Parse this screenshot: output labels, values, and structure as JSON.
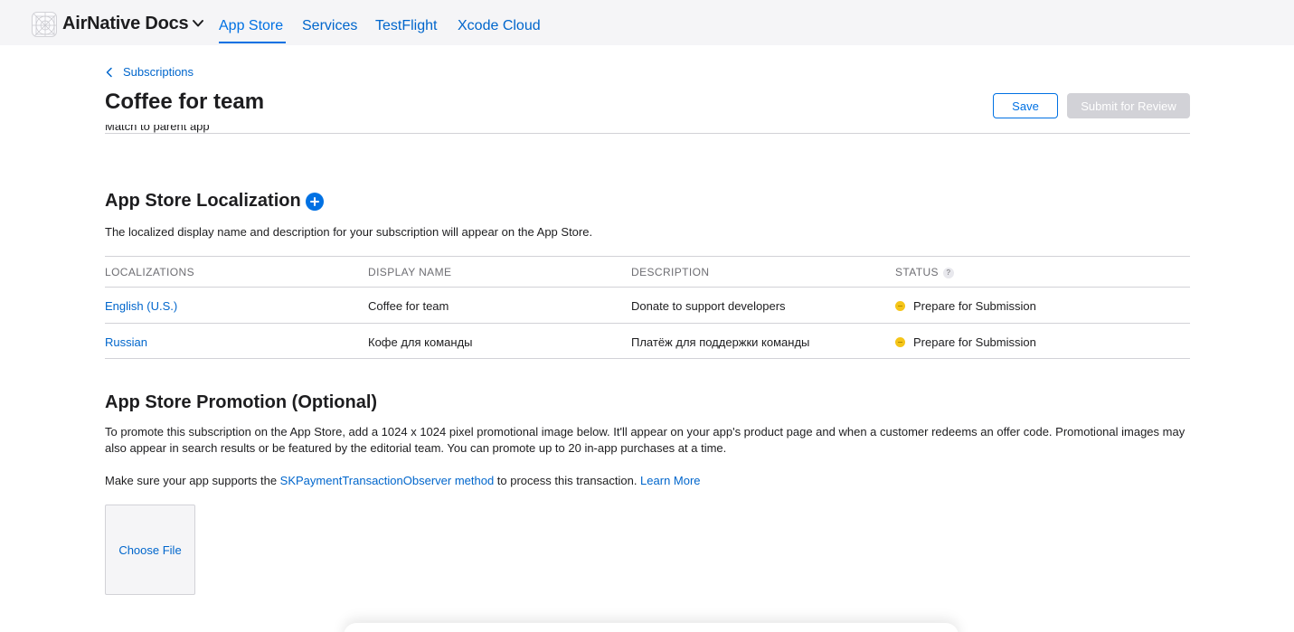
{
  "nav": {
    "brand": "AirNative Docs",
    "tabs": [
      {
        "label": "App Store",
        "active": true
      },
      {
        "label": "Services",
        "active": false
      },
      {
        "label": "TestFlight",
        "active": false
      },
      {
        "label": "Xcode Cloud",
        "active": false
      }
    ]
  },
  "header": {
    "breadcrumb": "Subscriptions",
    "title": "Coffee for team",
    "save_label": "Save",
    "submit_label": "Submit for Review",
    "cut_text": "Match to parent app"
  },
  "localization": {
    "title": "App Store Localization",
    "description": "The localized display name and description for your subscription will appear on the App Store.",
    "columns": [
      "LOCALIZATIONS",
      "DISPLAY NAME",
      "DESCRIPTION",
      "STATUS"
    ],
    "help_icon_glyph": "?",
    "rows": [
      {
        "locale": "English (U.S.)",
        "display_name": "Coffee for team",
        "description": "Donate to support developers",
        "status": "Prepare for Submission"
      },
      {
        "locale": "Russian",
        "display_name": "Кофе для команды",
        "description": "Платёж для поддержки команды",
        "status": "Prepare for Submission"
      }
    ]
  },
  "promotion": {
    "title": "App Store Promotion (Optional)",
    "paragraph": "To promote this subscription on the App Store, add a 1024 x 1024 pixel promotional image below. It'll appear on your app's product page and when a customer redeems an offer code. Promotional images may also appear in search results or be featured by the editorial team. You can promote up to 20 in-app purchases at a time.",
    "note_prefix": "Make sure your app supports the ",
    "note_link": "SKPaymentTransactionObserver method",
    "note_suffix": " to process this transaction. ",
    "learn_more": "Learn More",
    "choose_file": "Choose File"
  },
  "colors": {
    "accent": "#0071e3",
    "link": "#0066cc",
    "status_pending": "#f5c518",
    "disabled_button": "#d2d2d7"
  },
  "icons": [
    "app-logo-icon",
    "chevron-down-icon",
    "chevron-left-icon",
    "add-circle-icon",
    "help-icon",
    "status-pending-icon"
  ]
}
